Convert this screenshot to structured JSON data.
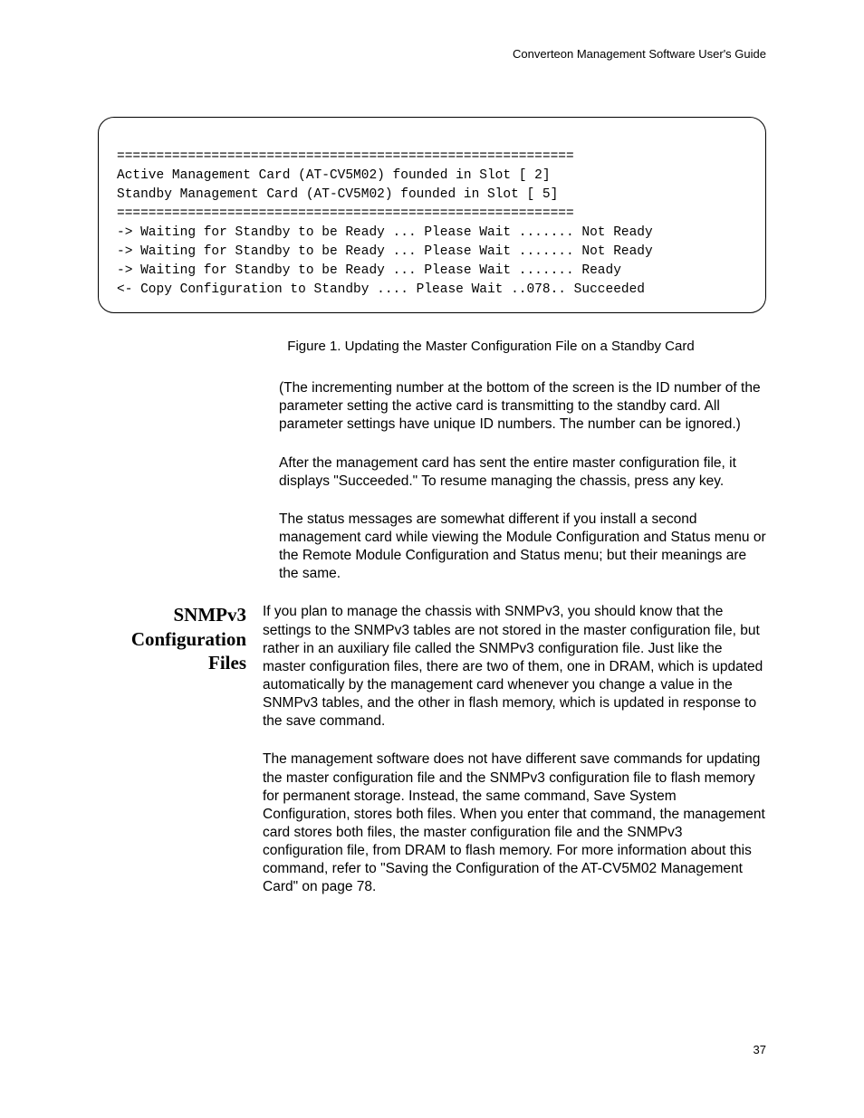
{
  "header": "Converteon Management Software User's Guide",
  "terminal": {
    "l1": "==========================================================",
    "l2": "Active Management Card (AT-CV5M02) founded in Slot [ 2]",
    "l3": "Standby Management Card (AT-CV5M02) founded in Slot [ 5]",
    "l4": "==========================================================",
    "l5": "-> Waiting for Standby to be Ready ... Please Wait ....... Not Ready",
    "l6": "-> Waiting for Standby to be Ready ... Please Wait ....... Not Ready",
    "l7": "-> Waiting for Standby to be Ready ... Please Wait ....... Ready",
    "l8": "<- Copy Configuration to Standby .... Please Wait ..078.. Succeeded"
  },
  "figure_caption": "Figure 1. Updating the Master Configuration File on a Standby Card",
  "para1": "(The incrementing number at the bottom of the screen is the ID number of the parameter setting the active card is transmitting to the standby card. All parameter settings have unique ID numbers. The number can be ignored.)",
  "para2": "After the management card has sent the entire master configuration file, it displays \"Succeeded.\" To resume managing the chassis, press any key.",
  "para3": "The status messages are somewhat different if you install a second management card while viewing the Module Configuration and Status menu or the Remote Module Configuration and Status menu; but their meanings are the same.",
  "section": {
    "title_l1": "SNMPv3",
    "title_l2": "Configuration",
    "title_l3": "Files",
    "p1": "If you plan to manage the chassis with SNMPv3, you should know that the settings to the SNMPv3 tables are not stored in the master configuration file, but rather in an auxiliary file called the SNMPv3 configuration file. Just like the master configuration files, there are two of them, one in DRAM, which is updated automatically by the management card whenever you change a value in the SNMPv3 tables, and the other in flash memory, which is updated in response to the save command.",
    "p2": "The management software does not have different save commands for updating the master configuration file and the SNMPv3 configuration file to flash memory for permanent storage. Instead, the same command, Save System Configuration, stores both files. When you enter that command, the management card stores both files, the master configuration file and the SNMPv3 configuration file, from DRAM to flash memory. For more information about this command, refer to \"Saving the Configuration of the AT-CV5M02 Management Card\" on page 78."
  },
  "page_number": "37"
}
